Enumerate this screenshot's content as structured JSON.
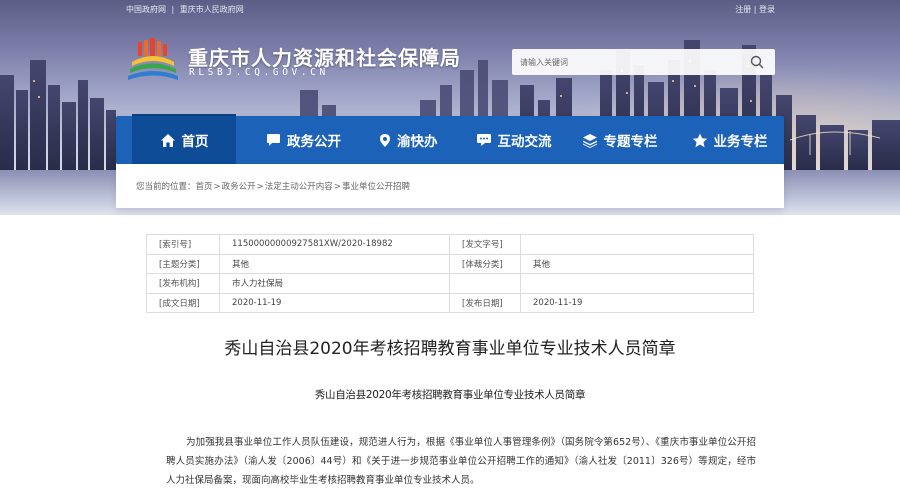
{
  "topbar": {
    "links": [
      "中国政府网",
      "|",
      "重庆市人民政府网"
    ],
    "login": "注册",
    "divider": "|",
    "register": "登录"
  },
  "site": {
    "title": "重庆市人力资源和社会保障局",
    "url": "RLSBJ.CQ.GOV.CN"
  },
  "search": {
    "placeholder": "请输入关键词",
    "icon": "search-icon"
  },
  "nav": {
    "items": [
      {
        "label": "首页",
        "icon": "home-icon"
      },
      {
        "label": "政务公开",
        "icon": "chat-icon"
      },
      {
        "label": "渝快办",
        "icon": "pin-icon"
      },
      {
        "label": "互动交流",
        "icon": "comment-icon"
      },
      {
        "label": "专题专栏",
        "icon": "layers-icon"
      },
      {
        "label": "业务专栏",
        "icon": "star-icon"
      }
    ]
  },
  "breadcrumb": {
    "prefix": "您当前的位置：",
    "items": [
      "首页",
      "政务公开",
      "法定主动公开内容",
      "事业单位公开招聘"
    ],
    "separator": ">"
  },
  "meta": {
    "rows": [
      [
        {
          "k": "[索引号]",
          "v": "11500000000927581XW/2020-18982"
        },
        {
          "k": "[发文字号]",
          "v": ""
        }
      ],
      [
        {
          "k": "[主题分类]",
          "v": "其他"
        },
        {
          "k": "[体裁分类]",
          "v": "其他"
        }
      ],
      [
        {
          "k": "[发布机构]",
          "v": "市人力社保局"
        }
      ],
      [
        {
          "k": "[成文日期]",
          "v": "2020-11-19"
        },
        {
          "k": "[发布日期]",
          "v": "2020-11-19"
        }
      ]
    ]
  },
  "article": {
    "title": "秀山自治县2020年考核招聘教育事业单位专业技术人员简章",
    "subtitle": "秀山自治县2020年考核招聘教育事业单位专业技术人员简章",
    "paragraph": "为加强我县事业单位工作人员队伍建设，规范进人行为，根据《事业单位人事管理条例》（国务院令第652号）、《重庆市事业单位公开招聘人员实施办法》（渝人发〔2006〕44号）和《关于进一步规范事业单位公开招聘工作的通知》（渝人社发〔2011〕326号）等规定，经市人力社保局备案，现面向高校毕业生考核招聘教育事业单位专业技术人员。"
  },
  "colors": {
    "nav_bg": "#1c62b8",
    "nav_active": "#0f4c97"
  }
}
